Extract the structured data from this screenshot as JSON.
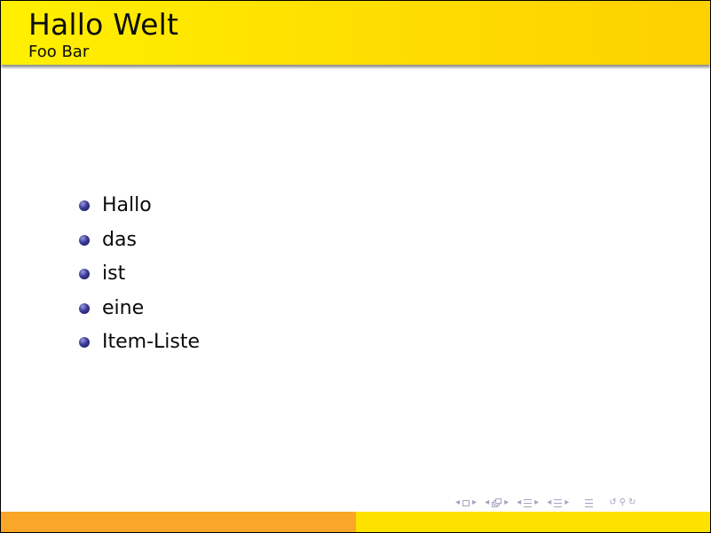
{
  "slide": {
    "title": "Hallo Welt",
    "subtitle": "Foo Bar",
    "items": [
      "Hallo",
      "das",
      "ist",
      "eine",
      "Item-Liste"
    ]
  },
  "navigation": {
    "icons": [
      "nav-prev-slide-icon",
      "nav-slide-icon",
      "nav-next-slide-icon",
      "nav-prev-frame-icon",
      "nav-frame-icon",
      "nav-next-frame-icon",
      "nav-prev-subsection-icon",
      "nav-subsection-icon",
      "nav-next-subsection-icon",
      "nav-prev-section-icon",
      "nav-section-icon",
      "nav-next-section-icon",
      "nav-appendix-icon",
      "nav-back-icon",
      "nav-search-icon",
      "nav-forward-icon"
    ],
    "symbol_color": "#a3a3c4"
  },
  "theme": {
    "header_color": "#fee000",
    "footer_left_color": "#faa628",
    "footer_right_color": "#fde200",
    "bullet_color": "#2e2e82"
  }
}
